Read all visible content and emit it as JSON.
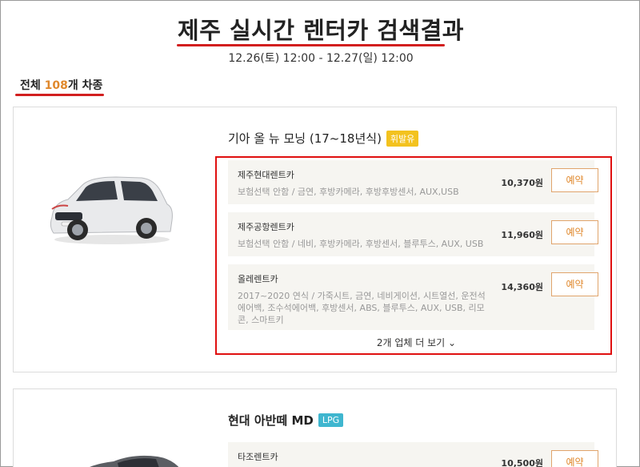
{
  "header": {
    "title": "제주 실시간 렌터카 검색결과",
    "date_range": "12.26(토) 12:00 - 12.27(일) 12:00",
    "total_prefix": "전체 ",
    "total_count": "108",
    "total_suffix": "개 차종"
  },
  "cars": [
    {
      "name": "기아 올 뉴 모닝 (17~18년식)",
      "fuel": "휘발유",
      "fuel_color": "#f3c21e",
      "offers": [
        {
          "company": "제주현대렌트카",
          "options": "보험선택 안함 / 금연, 후방카메라, 후방후방센서, AUX,USB",
          "price": "10,370원",
          "button": "예약"
        },
        {
          "company": "제주공항렌트카",
          "options": "보험선택 안함 / 네비, 후방카메라, 후방센서, 블루투스, AUX, USB",
          "price": "11,960원",
          "button": "예약"
        },
        {
          "company": "올레렌트카",
          "options": "2017~2020 연식 / 가죽시트, 금연, 네비게이션, 시트열선, 운전석에어백, 조수석에어백, 후방센서, ABS, 블루투스, AUX, USB, 리모콘, 스마트키",
          "price": "14,360원",
          "button": "예약"
        }
      ],
      "more_label": "2개 업체 더 보기 ⌄"
    },
    {
      "name": "현대 아반떼 MD",
      "fuel": "LPG",
      "fuel_color": "#3fb6cf",
      "offers": [
        {
          "company": "타조렌트카",
          "options": "",
          "price": "10,500원",
          "button": "예약"
        }
      ]
    }
  ],
  "colors": {
    "accent": "#e0882c",
    "highlight": "#e01010"
  }
}
